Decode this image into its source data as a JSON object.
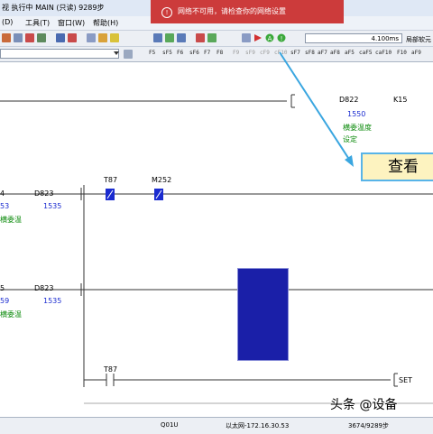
{
  "window": {
    "title": "视 执行中 MAIN (只读) 9289步"
  },
  "menu": {
    "items": [
      "(D)",
      "工具(T)",
      "窗口(W)",
      "帮助(H)"
    ]
  },
  "notification": {
    "text": "网络不可用，请检查你的网络设置"
  },
  "toolbar": {
    "scan_time": "4.100ms",
    "soft_element": "局部软元",
    "fkeys": [
      "F5",
      "sF5",
      "F6",
      "sF6",
      "F7",
      "F8",
      "F9",
      "sF9",
      "cF9",
      "cF10",
      "sF7",
      "sF8",
      "aF7",
      "aF8",
      "aF5",
      "caF5",
      "caF10",
      "F10",
      "aF9"
    ]
  },
  "ladder": {
    "top_coil": {
      "device": "D822",
      "value_device": "K15",
      "current": "1550",
      "comment1": "横委温度",
      "comment2": "设定"
    },
    "row1": {
      "left_dev_partial": "4",
      "left_val_partial": "53",
      "left_comment_partial": "横委温",
      "dev": "D823",
      "val": "1535",
      "contact1": "T87",
      "contact2": "M252"
    },
    "row2": {
      "left_dev_partial": "5",
      "left_val_partial": "59",
      "left_comment_partial": "横委温",
      "dev": "D823",
      "val": "1535"
    },
    "row3": {
      "contact": "T87",
      "instruction": "SET"
    }
  },
  "callout": {
    "text": "查看"
  },
  "status": {
    "cpu": "Q01U",
    "connection": "以太网-172.16.30.53",
    "steps": "3674/9289步"
  },
  "watermark": {
    "text": "头条 @设备"
  },
  "colors": {
    "contact_on": "#1a2bd0",
    "monitor_block": "#1a1fa8",
    "notice_bg": "#cc3b3b",
    "arrow": "#3aa6e0"
  }
}
